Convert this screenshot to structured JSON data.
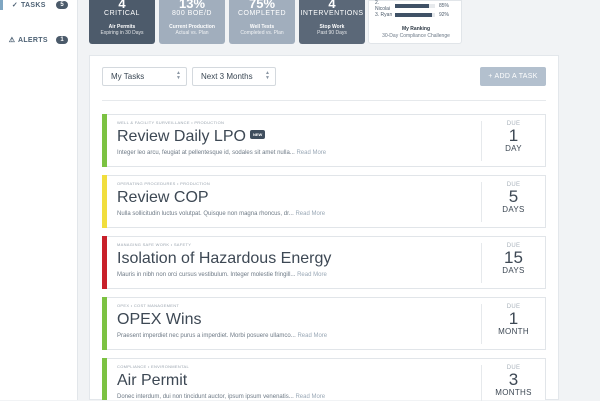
{
  "sidebar": {
    "items": [
      {
        "icon": "check-icon",
        "glyph": "✓",
        "label": "TASKS",
        "count": "5"
      },
      {
        "icon": "warning-icon",
        "glyph": "⚠",
        "label": "ALERTS",
        "count": "1"
      }
    ]
  },
  "stats": [
    {
      "value": "4",
      "caption": "CRITICAL",
      "sub": "Air Permits",
      "sub2": "Expiring in 30 Days",
      "color": "#4d5b6b"
    },
    {
      "value": "13%",
      "caption": "800 BOE/D",
      "sub": "Current Production",
      "sub2": "Actual vs. Plan",
      "color": "#a1aebd"
    },
    {
      "value": "75%",
      "caption": "COMPLETED",
      "sub": "Well Tests",
      "sub2": "Completed vs. Plan",
      "color": "#a1aebd"
    },
    {
      "value": "4",
      "caption": "INTERVENTIONS",
      "sub": "Stop Work",
      "sub2": "Past 90 Days",
      "color": "#5b6878"
    }
  ],
  "ranking": {
    "rows": [
      {
        "name": "2. Nicolai",
        "percent": "85%",
        "fill": 0.85
      },
      {
        "name": "3. Ryan",
        "percent": "92%",
        "fill": 0.92
      }
    ],
    "title": "My Ranking",
    "subtitle": "30-Day Compliance Challenge"
  },
  "filters": {
    "tasks": "My Tasks",
    "range": "Next 3 Months"
  },
  "add_button": "+ ADD A TASK",
  "due_label": "DUE",
  "tasks": [
    {
      "meta": "WELL & FACILITY SURVEILLANCE  •  PRODUCTION",
      "title": "Review Daily LPO",
      "badge": "NEW",
      "desc": "Integer leo arcu, feugiat at pellentesque id, sodales sit amet nulla...",
      "more": "Read More",
      "num": "1",
      "unit": "DAY",
      "color": "#7cc242"
    },
    {
      "meta": "OPERATING PROCEDURES  •  PRODUCTION",
      "title": "Review COP",
      "badge": "",
      "desc": "Nulla sollicitudin luctus volutpat. Quisque non magna rhoncus, dr...",
      "more": "Read More",
      "num": "5",
      "unit": "DAYS",
      "color": "#f1de3d"
    },
    {
      "meta": "MANAGING SAFE WORK  •  SAFETY",
      "title": "Isolation of Hazardous Energy",
      "badge": "",
      "desc": "Mauris in nibh non orci cursus vestibulum. Integer molestie fringill...",
      "more": "Read More",
      "num": "15",
      "unit": "DAYS",
      "color": "#c8202a"
    },
    {
      "meta": "OPEX  •  COST MANAGEMENT",
      "title": "OPEX Wins",
      "badge": "",
      "desc": "Praesent imperdiet nec purus a imperdiet. Morbi posuere ullamco...",
      "more": "Read More",
      "num": "1",
      "unit": "MONTH",
      "color": "#7cc242"
    },
    {
      "meta": "COMPLIANCE  •  ENVIRONMENTAL",
      "title": "Air Permit",
      "badge": "",
      "desc": "Donec interdum, dui non tincidunt auctor, ipsum ipsum venenatis...",
      "more": "Read More",
      "num": "3",
      "unit": "MONTHS",
      "color": "#7cc242"
    }
  ]
}
